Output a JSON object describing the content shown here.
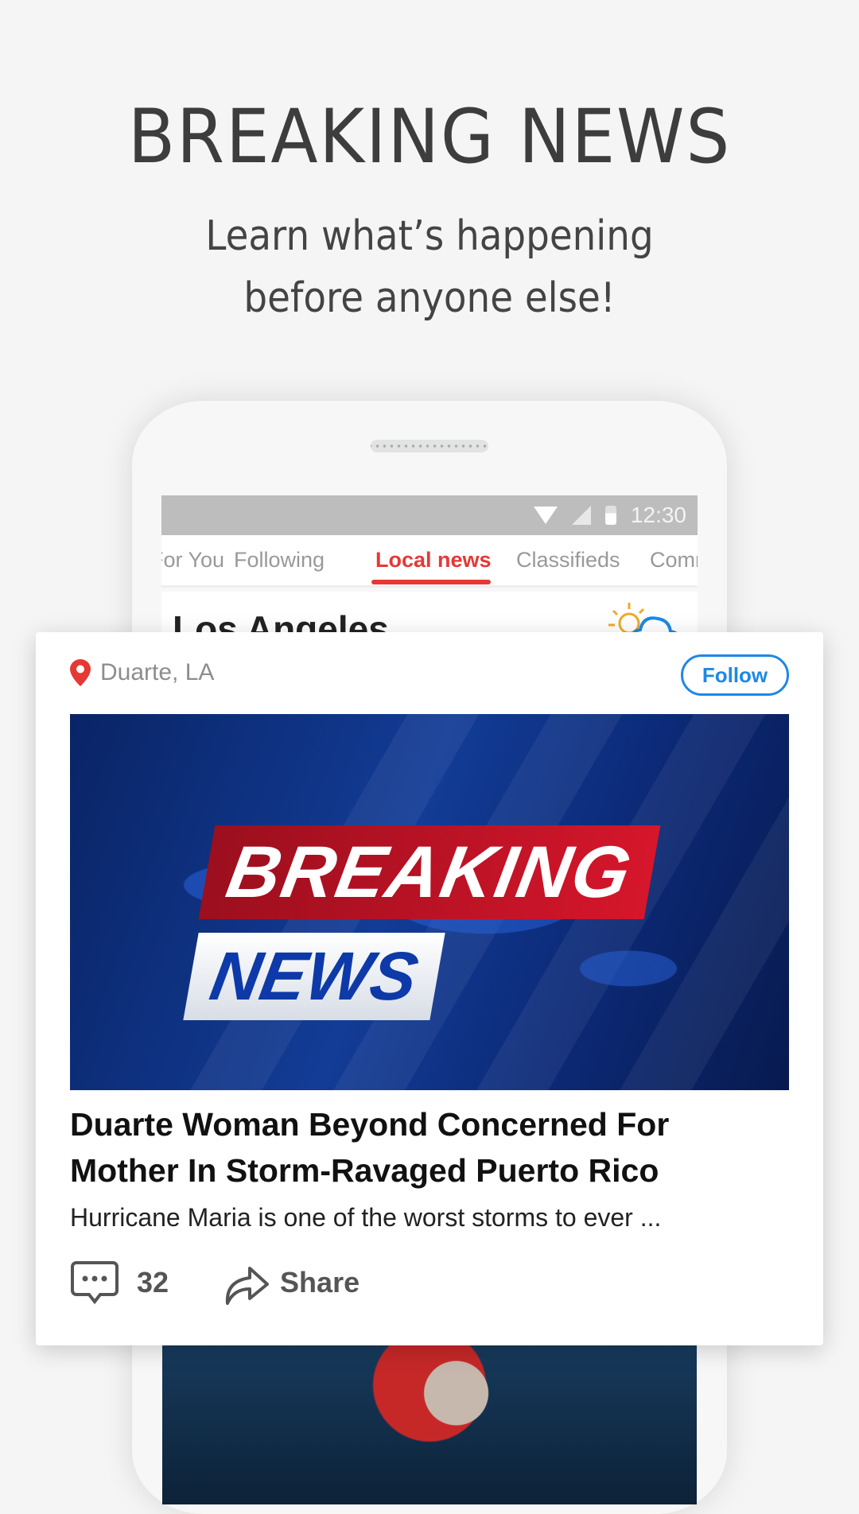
{
  "hero": {
    "title": "BREAKING NEWS",
    "subtitle_line1": "Learn what’s happening",
    "subtitle_line2": "before anyone else!"
  },
  "status_bar": {
    "time": "12:30"
  },
  "tabs": [
    {
      "label": "For You"
    },
    {
      "label": "Following"
    },
    {
      "label": "Local news",
      "active": true
    },
    {
      "label": "Classifieds"
    },
    {
      "label": "Community"
    }
  ],
  "tabs_visible": [
    "or You",
    "Following",
    "Local news",
    "Classifieds",
    "Com"
  ],
  "city": {
    "name": "Los Angeles",
    "weather_icon": "partly-cloudy-icon"
  },
  "article": {
    "location": "Duarte, LA",
    "follow_label": "Follow",
    "image_text_1": "BREAKING",
    "image_text_2": "NEWS",
    "title": "Duarte Woman Beyond Concerned For Mother In Storm-Ravaged Puerto Rico",
    "snippet": "Hurricane Maria is one of the worst storms to ever ...",
    "comment_count": "32",
    "share_label": "Share"
  },
  "colors": {
    "accent_red": "#e53935",
    "follow_blue": "#1e88e5"
  }
}
